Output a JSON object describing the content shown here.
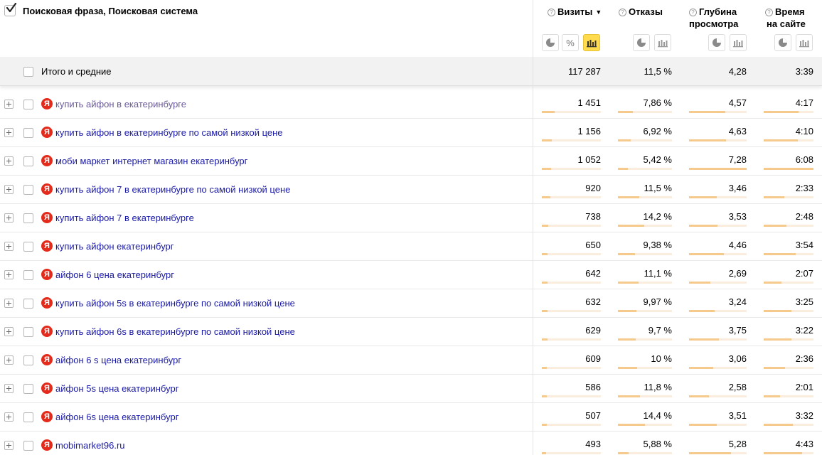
{
  "header": {
    "dimension_title": "Поисковая фраза, Поисковая система",
    "columns": [
      {
        "label_line1": "Визиты",
        "label_line2": "",
        "sorted": true
      },
      {
        "label_line1": "Отказы",
        "label_line2": ""
      },
      {
        "label_line1": "Глубина",
        "label_line2": "просмотра"
      },
      {
        "label_line1": "Время",
        "label_line2": "на сайте"
      }
    ],
    "help_glyph": "?",
    "sort_glyph": "▼",
    "percent_glyph": "%"
  },
  "summary": {
    "label": "Итого и средние",
    "visits": "117 287",
    "bounce": "11,5 %",
    "depth": "4,28",
    "time": "3:39"
  },
  "engine_badge": "Я",
  "rows": [
    {
      "phrase": "купить айфон в екатеринбурге",
      "visits": "1 451",
      "bounce": "7,86 %",
      "depth": "4,57",
      "time": "4:17",
      "visited": true,
      "bar_visits": 0.22,
      "bar_bounce": 0.27,
      "bar_depth": 0.63,
      "bar_time": 0.7
    },
    {
      "phrase": "купить айфон в екатеринбурге по самой низкой цене",
      "visits": "1 156",
      "bounce": "6,92 %",
      "depth": "4,63",
      "time": "4:10",
      "visited": false,
      "bar_visits": 0.17,
      "bar_bounce": 0.24,
      "bar_depth": 0.64,
      "bar_time": 0.68
    },
    {
      "phrase": "моби маркет интернет магазин екатеринбург",
      "visits": "1 052",
      "bounce": "5,42 %",
      "depth": "7,28",
      "time": "6:08",
      "visited": false,
      "bar_visits": 0.16,
      "bar_bounce": 0.19,
      "bar_depth": 1.0,
      "bar_time": 1.0
    },
    {
      "phrase": "купить айфон 7 в екатеринбурге по самой низкой цене",
      "visits": "920",
      "bounce": "11,5 %",
      "depth": "3,46",
      "time": "2:33",
      "visited": false,
      "bar_visits": 0.14,
      "bar_bounce": 0.4,
      "bar_depth": 0.48,
      "bar_time": 0.42
    },
    {
      "phrase": "купить айфон 7 в екатеринбурге",
      "visits": "738",
      "bounce": "14,2 %",
      "depth": "3,53",
      "time": "2:48",
      "visited": false,
      "bar_visits": 0.11,
      "bar_bounce": 0.49,
      "bar_depth": 0.49,
      "bar_time": 0.46
    },
    {
      "phrase": "купить айфон екатеринбург",
      "visits": "650",
      "bounce": "9,38 %",
      "depth": "4,46",
      "time": "3:54",
      "visited": false,
      "bar_visits": 0.1,
      "bar_bounce": 0.32,
      "bar_depth": 0.61,
      "bar_time": 0.64
    },
    {
      "phrase": "айфон 6 цена екатеринбург",
      "visits": "642",
      "bounce": "11,1 %",
      "depth": "2,69",
      "time": "2:07",
      "visited": false,
      "bar_visits": 0.1,
      "bar_bounce": 0.38,
      "bar_depth": 0.37,
      "bar_time": 0.35
    },
    {
      "phrase": "купить айфон 5s в екатеринбурге по самой низкой цене",
      "visits": "632",
      "bounce": "9,97 %",
      "depth": "3,24",
      "time": "3:25",
      "visited": false,
      "bar_visits": 0.1,
      "bar_bounce": 0.34,
      "bar_depth": 0.45,
      "bar_time": 0.56
    },
    {
      "phrase": "купить айфон 6s в екатеринбурге по самой низкой цене",
      "visits": "629",
      "bounce": "9,7 %",
      "depth": "3,75",
      "time": "3:22",
      "visited": false,
      "bar_visits": 0.1,
      "bar_bounce": 0.33,
      "bar_depth": 0.52,
      "bar_time": 0.55
    },
    {
      "phrase": "айфон 6 s цена екатеринбург",
      "visits": "609",
      "bounce": "10 %",
      "depth": "3,06",
      "time": "2:36",
      "visited": false,
      "bar_visits": 0.09,
      "bar_bounce": 0.35,
      "bar_depth": 0.42,
      "bar_time": 0.43
    },
    {
      "phrase": "айфон 5s цена екатеринбург",
      "visits": "586",
      "bounce": "11,8 %",
      "depth": "2,58",
      "time": "2:01",
      "visited": false,
      "bar_visits": 0.09,
      "bar_bounce": 0.41,
      "bar_depth": 0.35,
      "bar_time": 0.33
    },
    {
      "phrase": "айфон 6s цена екатеринбург",
      "visits": "507",
      "bounce": "14,4 %",
      "depth": "3,51",
      "time": "3:32",
      "visited": false,
      "bar_visits": 0.08,
      "bar_bounce": 0.5,
      "bar_depth": 0.48,
      "bar_time": 0.58
    },
    {
      "phrase": "mobimarket96.ru",
      "visits": "493",
      "bounce": "5,88 %",
      "depth": "5,28",
      "time": "4:43",
      "visited": false,
      "bar_visits": 0.07,
      "bar_bounce": 0.2,
      "bar_depth": 0.73,
      "bar_time": 0.77
    }
  ]
}
